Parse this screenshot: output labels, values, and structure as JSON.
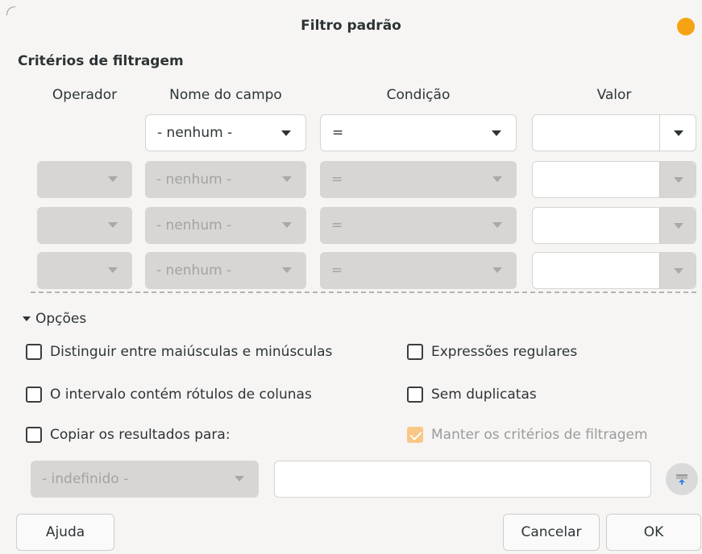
{
  "dialog": {
    "title": "Filtro padrão"
  },
  "criteria": {
    "section_title": "Critérios de filtragem",
    "headers": {
      "operator": "Operador",
      "field": "Nome do campo",
      "condition": "Condição",
      "value": "Valor"
    },
    "rows": [
      {
        "operator": "",
        "field": "- nenhum -",
        "condition": "=",
        "value": "",
        "enabled": true
      },
      {
        "operator": "",
        "field": "- nenhum -",
        "condition": "=",
        "value": "",
        "enabled": false
      },
      {
        "operator": "",
        "field": "- nenhum -",
        "condition": "=",
        "value": "",
        "enabled": false
      },
      {
        "operator": "",
        "field": "- nenhum -",
        "condition": "=",
        "value": "",
        "enabled": false
      }
    ]
  },
  "options": {
    "expander_label": "Opções",
    "case_sensitive": {
      "label": "Distinguir entre maiúsculas e minúsculas",
      "checked": false
    },
    "regex": {
      "label": "Expressões regulares",
      "checked": false
    },
    "header": {
      "label": "O intervalo contém rótulos de colunas",
      "checked": false
    },
    "no_duplicates": {
      "label": "Sem duplicatas",
      "checked": false
    },
    "copy_results": {
      "label": "Copiar os resultados para:",
      "checked": false
    },
    "keep_criteria": {
      "label": "Manter os critérios de filtragem",
      "checked": true,
      "enabled": false
    },
    "copy_target_select": "- indefinido -",
    "copy_target_value": ""
  },
  "buttons": {
    "help": "Ajuda",
    "cancel": "Cancelar",
    "ok": "OK"
  },
  "icons": {
    "close": "close-dot-icon",
    "shrink": "shrink-range-icon",
    "expander": "triangle-down-icon"
  },
  "colors": {
    "accent": "#f6a313",
    "checkbox_disabled_checked": "#f9c784"
  }
}
